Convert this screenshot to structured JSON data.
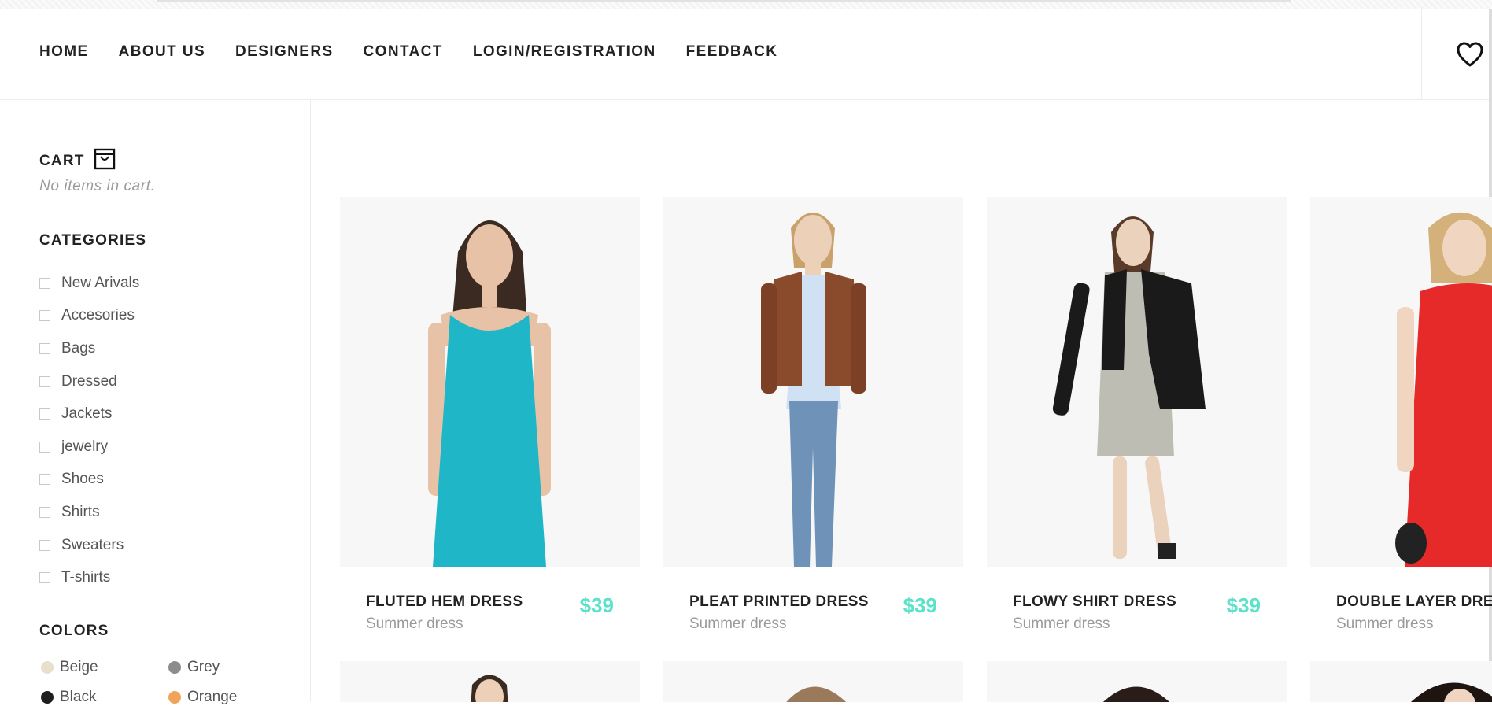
{
  "nav": {
    "items": [
      "HOME",
      "ABOUT US",
      "DESIGNERS",
      "CONTACT",
      "LOGIN/REGISTRATION",
      "FEEDBACK"
    ]
  },
  "sidebar": {
    "cart_title": "CART",
    "cart_empty": "No items in cart.",
    "categories_title": "CATEGORIES",
    "categories": [
      "New Arivals",
      "Accesories",
      "Bags",
      "Dressed",
      "Jackets",
      "jewelry",
      "Shoes",
      "Shirts",
      "Sweaters",
      "T-shirts"
    ],
    "colors_title": "COLORS",
    "colors": [
      {
        "label": "Beige",
        "hex": "#e8e0cc"
      },
      {
        "label": "Grey",
        "hex": "#8c8c8c"
      },
      {
        "label": "Black",
        "hex": "#1e1e1e"
      },
      {
        "label": "Orange",
        "hex": "#f0a35a"
      }
    ]
  },
  "products": [
    {
      "name": "FLUTED HEM DRESS",
      "subtitle": "Summer dress",
      "price": "$39",
      "garment": "#1fb7c8"
    },
    {
      "name": "PLEAT PRINTED DRESS",
      "subtitle": "Summer dress",
      "price": "$39",
      "garment": "#8a4a2c"
    },
    {
      "name": "FLOWY SHIRT DRESS",
      "subtitle": "Summer dress",
      "price": "$39",
      "garment": "#1a1a1a"
    },
    {
      "name": "DOUBLE LAYER DRESS",
      "subtitle": "Summer dress",
      "price": "",
      "garment": "#e62a2a"
    }
  ],
  "accent_color": "#5ce2c9"
}
